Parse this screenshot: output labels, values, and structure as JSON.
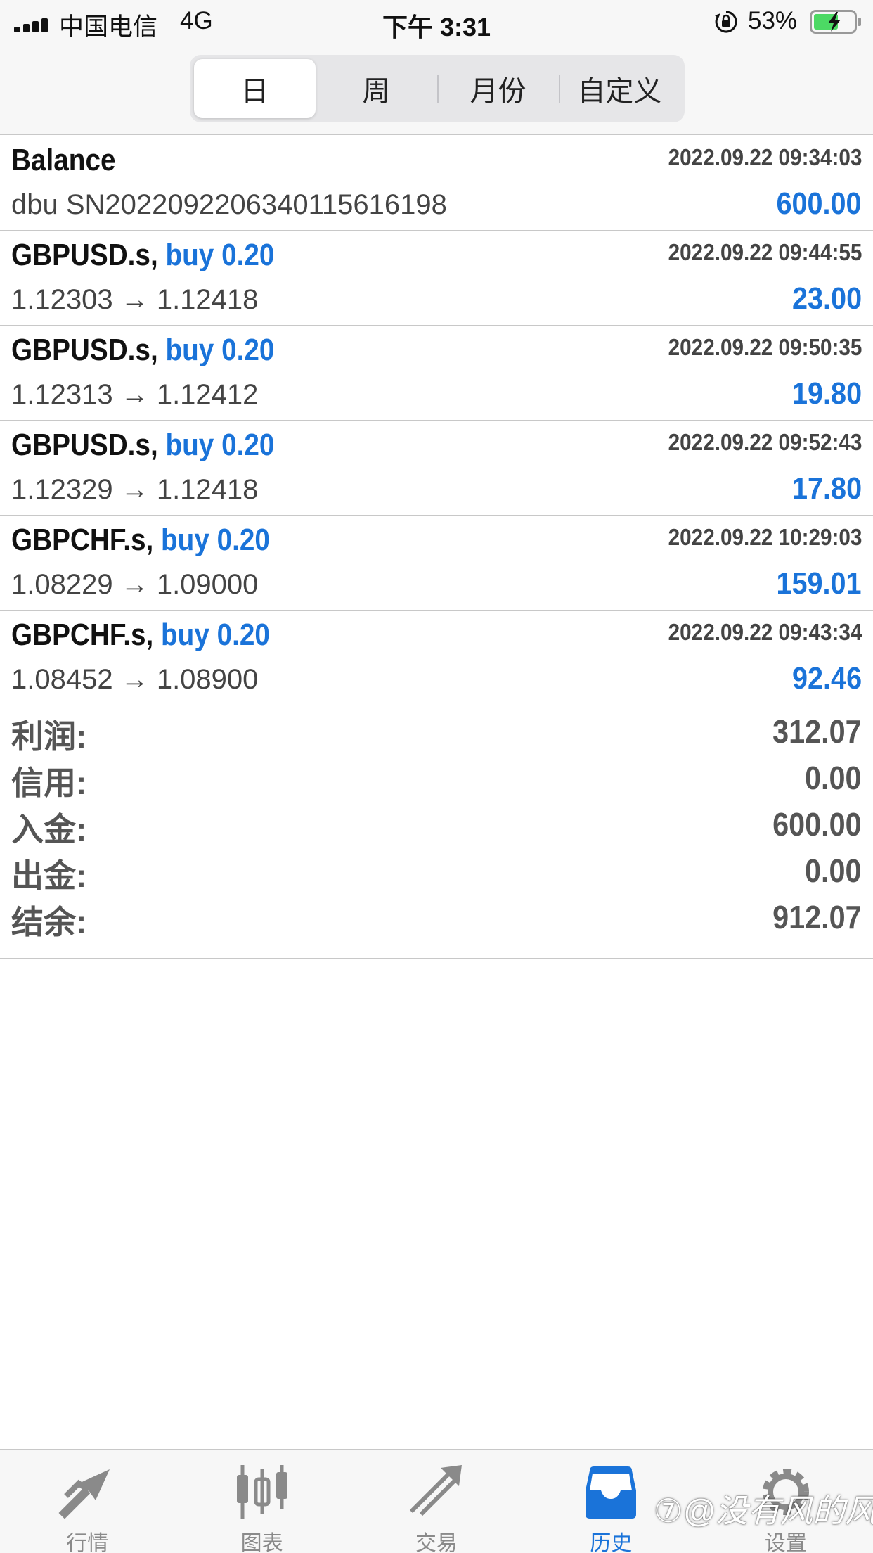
{
  "status_bar": {
    "carrier": "中国电信",
    "network": "4G",
    "time": "下午 3:31",
    "battery": "53%"
  },
  "period_tabs": [
    {
      "label": "日",
      "active": true
    },
    {
      "label": "周",
      "active": false
    },
    {
      "label": "月份",
      "active": false
    },
    {
      "label": "自定义",
      "active": false
    }
  ],
  "deals": [
    {
      "title": "Balance",
      "side": "",
      "time": "2022.09.22 09:34:03",
      "sub": "dbu SN2022092206340115616198",
      "amount": "600.00"
    },
    {
      "title": "GBPUSD.s,",
      "side": "buy 0.20",
      "time": "2022.09.22 09:44:55",
      "sub": "1.12303 → 1.12418",
      "amount": "23.00"
    },
    {
      "title": "GBPUSD.s,",
      "side": "buy 0.20",
      "time": "2022.09.22 09:50:35",
      "sub": "1.12313 → 1.12412",
      "amount": "19.80"
    },
    {
      "title": "GBPUSD.s,",
      "side": "buy 0.20",
      "time": "2022.09.22 09:52:43",
      "sub": "1.12329 → 1.12418",
      "amount": "17.80"
    },
    {
      "title": "GBPCHF.s,",
      "side": "buy 0.20",
      "time": "2022.09.22 10:29:03",
      "sub": "1.08229 → 1.09000",
      "amount": "159.01"
    },
    {
      "title": "GBPCHF.s,",
      "side": "buy 0.20",
      "time": "2022.09.22 09:43:34",
      "sub": "1.08452 → 1.08900",
      "amount": "92.46"
    }
  ],
  "summary": [
    {
      "label": "利润:",
      "value": "312.07"
    },
    {
      "label": "信用:",
      "value": "0.00"
    },
    {
      "label": "入金:",
      "value": "600.00"
    },
    {
      "label": "出金:",
      "value": "0.00"
    },
    {
      "label": "结余:",
      "value": "912.07"
    }
  ],
  "tab_bar": [
    {
      "label": "行情",
      "icon": "quotes-icon",
      "active": false
    },
    {
      "label": "图表",
      "icon": "chart-icon",
      "active": false
    },
    {
      "label": "交易",
      "icon": "trade-icon",
      "active": false
    },
    {
      "label": "历史",
      "icon": "history-icon",
      "active": true
    },
    {
      "label": "设置",
      "icon": "gear-icon",
      "active": false
    }
  ],
  "watermark": "⑦@没有风的风",
  "colors": {
    "accent": "#1a73d9",
    "inactive_tab": "#8a8a8a",
    "summary_text": "#555555"
  }
}
